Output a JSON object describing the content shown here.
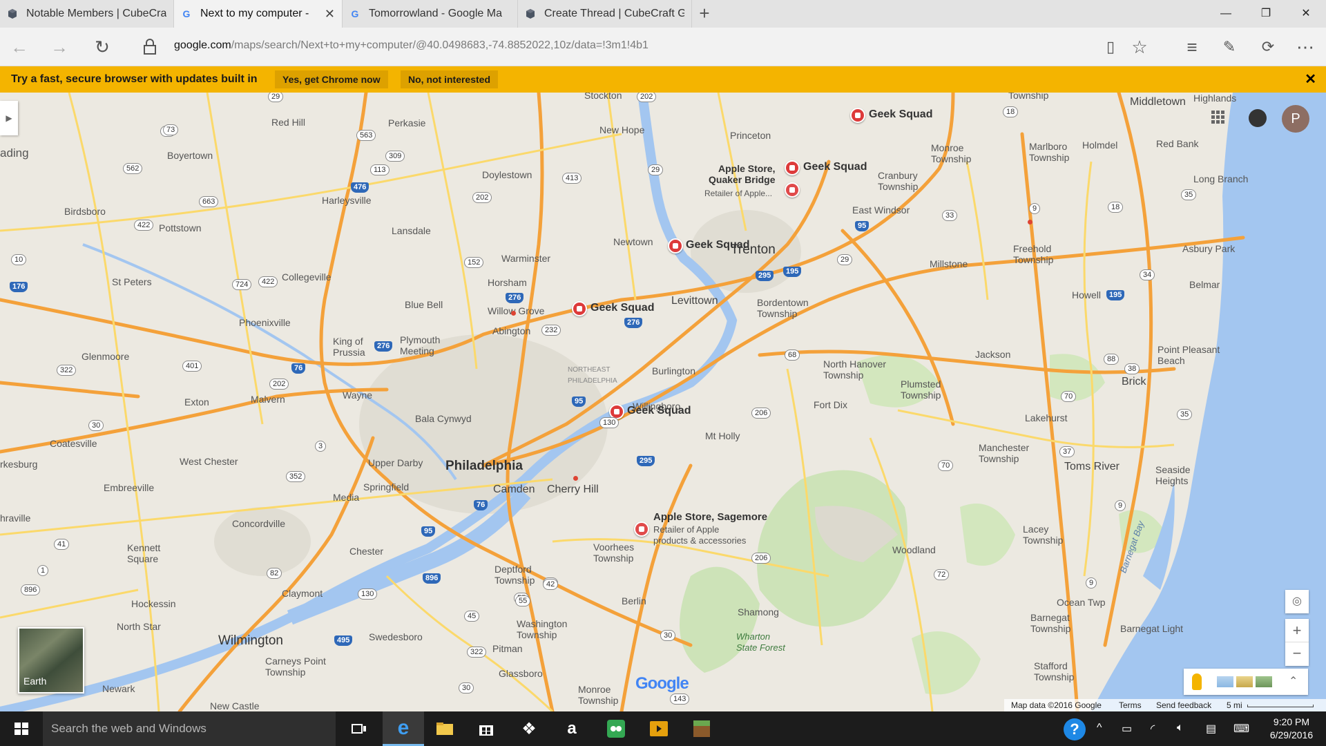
{
  "browser": {
    "tabs": [
      {
        "title": "Notable Members | CubeCra",
        "favicon": "cube-icon"
      },
      {
        "title": "Next to my computer -",
        "favicon": "google-icon",
        "active": true
      },
      {
        "title": "Tomorrowland - Google Ma",
        "favicon": "google-icon"
      },
      {
        "title": "Create Thread | CubeCraft G",
        "favicon": "cube-icon"
      }
    ],
    "url_host": "google.com",
    "url_path": "/maps/search/Next+to+my+computer/@40.0498683,-74.8852022,10z/data=!3m1!4b1"
  },
  "infobar": {
    "message": "Try a fast, secure browser with updates built in",
    "accept_label": "Yes, get Chrome now",
    "decline_label": "No, not interested",
    "close_glyph": "✕"
  },
  "map": {
    "profile_initial": "P",
    "earth_label": "Earth",
    "google_logo": "Google",
    "footer": {
      "map_data": "Map data ©2016 Google",
      "terms": "Terms",
      "feedback": "Send feedback",
      "scale": "5 mi"
    },
    "labels": {
      "philadelphia": "Philadelphia",
      "trenton": "Trenton",
      "wilmington": "Wilmington",
      "camden": "Camden",
      "cherry_hill": "Cherry Hill",
      "levittown": "Levittown",
      "toms_river": "Toms River",
      "brick": "Brick",
      "middletown": "Middletown",
      "princeton": "Princeton",
      "new_hope": "New Hope",
      "doylestown": "Doylestown",
      "perkasie": "Perkasie",
      "red_hill": "Red Hill",
      "boyertown": "Boyertown",
      "harleysville": "Harleysville",
      "lansdale": "Lansdale",
      "pottstown": "Pottstown",
      "birdsboro": "Birdsboro",
      "collegeville": "Collegeville",
      "phoenixville": "Phoenixville",
      "st_peters": "St Peters",
      "glenmoore": "Glenmoore",
      "exton": "Exton",
      "malvern": "Malvern",
      "wayne": "Wayne",
      "king_of_prussia": "King of\nPrussia",
      "plymouth_meeting": "Plymouth\nMeeting",
      "blue_bell": "Blue Bell",
      "horsham": "Horsham",
      "warminster": "Warminster",
      "willow_grove": "Willow Grove",
      "abington": "Abington",
      "bala_cynwyd": "Bala Cynwyd",
      "upper_darby": "Upper Darby",
      "springfield": "Springfield",
      "media": "Media",
      "west_chester": "West Chester",
      "coatesville": "Coatesville",
      "embreeville": "Embreeville",
      "concordville": "Concordville",
      "kennett_square": "Kennett\nSquare",
      "chester": "Chester",
      "claymont": "Claymont",
      "hockessin": "Hockessin",
      "north_star": "North Star",
      "newark": "Newark",
      "new_castle": "New Castle",
      "carneys_point": "Carneys Point\nTownship",
      "swedesboro": "Swedesboro",
      "pitman": "Pitman",
      "glassboro": "Glassboro",
      "washington_twp": "Washington\nTownship",
      "deptford": "Deptford\nTownship",
      "voorhees": "Voorhees\nTownship",
      "berlin": "Berlin",
      "monroe_twp_s": "Monroe\nTownship",
      "shamong": "Shamong",
      "wharton": "Wharton\nState Forest",
      "burlington": "Burlington",
      "willingboro": "Willingboro",
      "mt_holly": "Mt Holly",
      "newtown": "Newtown",
      "bordentown": "Bordentown\nTownship",
      "east_windsor": "East Windsor",
      "cranbury": "Cranbury\nTownship",
      "monroe_twp_n": "Monroe\nTownship",
      "millstone": "Millstone",
      "freehold": "Freehold\nTownship",
      "marlboro": "Marlboro\nTownship",
      "holmdel": "Holmdel",
      "red_bank": "Red Bank",
      "long_branch": "Long Branch",
      "asbury_park": "Asbury Park",
      "belmar": "Belmar",
      "howell": "Howell",
      "point_pleasant": "Point Pleasant\nBeach",
      "jackson": "Jackson",
      "north_hanover": "North Hanover\nTownship",
      "plumsted": "Plumsted\nTownship",
      "fort_dix": "Fort Dix",
      "lakehurst": "Lakehurst",
      "manchester": "Manchester\nTownship",
      "seaside_heights": "Seaside\nHeights",
      "lacey": "Lacey\nTownship",
      "woodland": "Woodland",
      "ocean_twp": "Ocean Twp",
      "barnegat_twp": "Barnegat\nTownship",
      "barnegat_light": "Barnegat Light",
      "barnegat_bay": "Barnegat Bay",
      "stafford": "Stafford\nTownship",
      "highlands": "Highlands",
      "township_n": "Township",
      "stockton": "Stockton",
      "northeast_phila": "NORTHEAST\nPHILADELPHIA",
      "ading": "ading",
      "rkesburg": "rkesburg",
      "hraville": "hraville"
    },
    "pois": [
      {
        "name": "Geek Squad"
      },
      {
        "name": "Geek Squad"
      },
      {
        "name": "Geek Squad"
      },
      {
        "name": "Geek Squad"
      },
      {
        "name": "Geek Squad"
      },
      {
        "name": "Apple Store,\nQuaker Bridge",
        "sub": "Retailer of Apple..."
      },
      {
        "name": "Apple Store, Sagemore",
        "sub": "Retailer of Apple\nproducts & accessories"
      }
    ],
    "shields": [
      "476",
      "276",
      "76",
      "95",
      "295",
      "195",
      "206",
      "70",
      "9",
      "30",
      "322",
      "202",
      "1",
      "41",
      "896",
      "896",
      "82",
      "130",
      "42",
      "55",
      "45",
      "143",
      "33",
      "18",
      "35",
      "34",
      "38",
      "3",
      "352",
      "401",
      "73",
      "663",
      "562",
      "422",
      "10",
      "176",
      "724",
      "422",
      "29",
      "563",
      "309",
      "113",
      "202",
      "152",
      "413",
      "29",
      "202",
      "232",
      "29",
      "130",
      "68",
      "70",
      "72",
      "9",
      "88",
      "35",
      "37",
      "9",
      "18",
      "206",
      "30",
      "322",
      "95",
      "295",
      "495",
      "76",
      "276",
      "276",
      "95",
      "195",
      "42",
      "55",
      "30",
      "73"
    ]
  },
  "taskbar": {
    "search_placeholder": "Search the web and Windows",
    "time": "9:20 PM",
    "date": "6/29/2016"
  }
}
